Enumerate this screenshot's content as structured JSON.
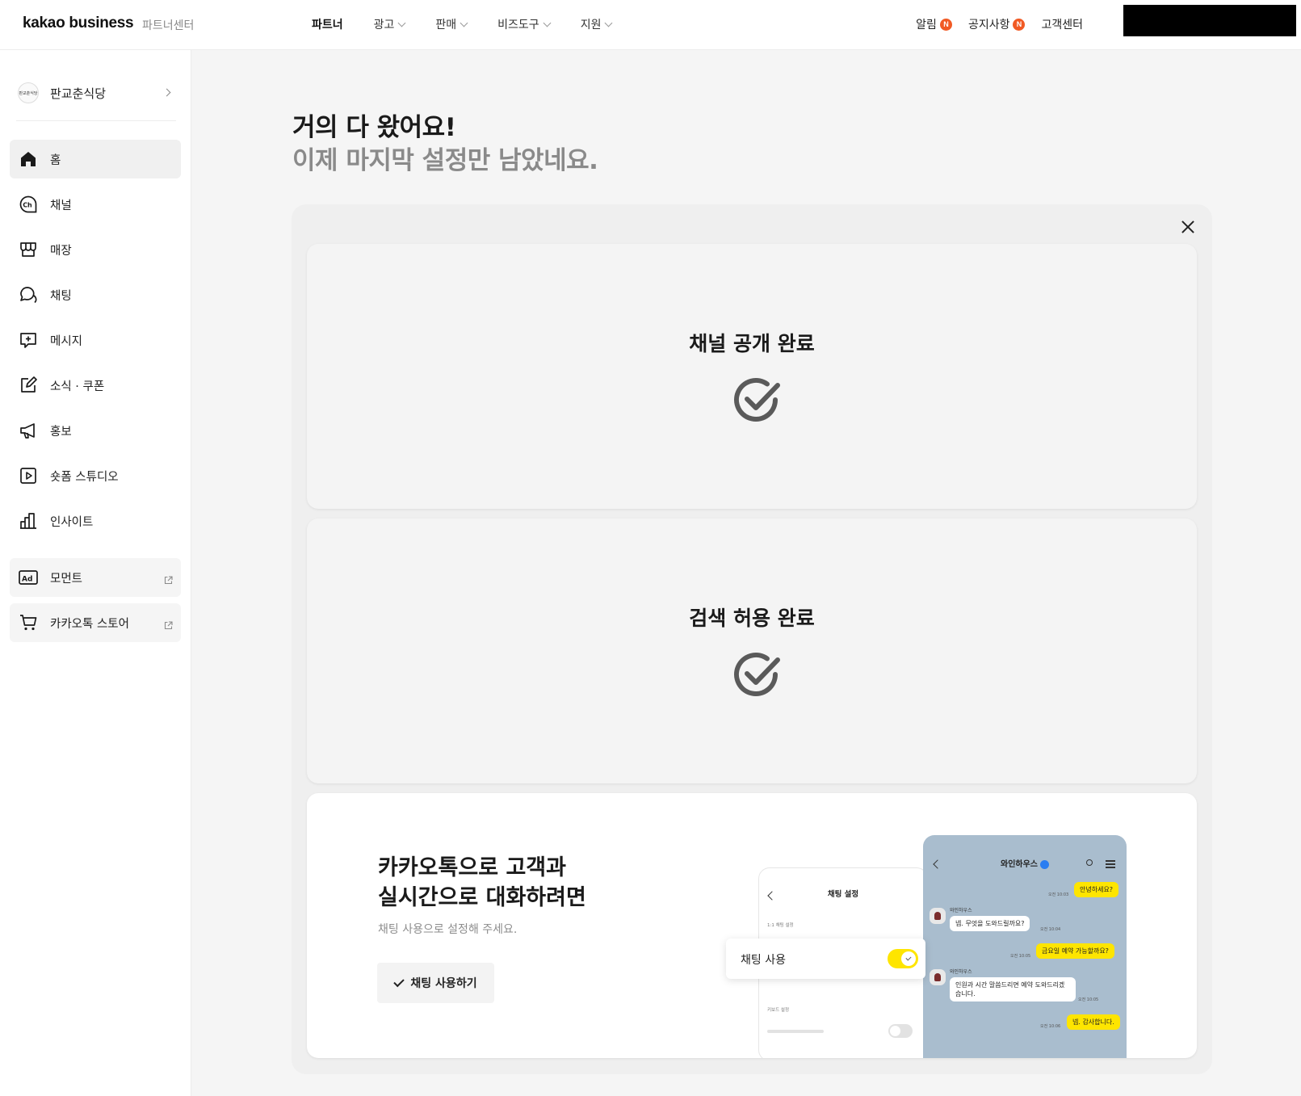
{
  "header": {
    "logo": "kakao business",
    "logo_sub": "파트너센터",
    "nav": [
      {
        "label": "파트너",
        "has_dropdown": false
      },
      {
        "label": "광고",
        "has_dropdown": true
      },
      {
        "label": "판매",
        "has_dropdown": true
      },
      {
        "label": "비즈도구",
        "has_dropdown": true
      },
      {
        "label": "지원",
        "has_dropdown": true
      }
    ],
    "util": {
      "alarm": "알림",
      "notice": "공지사항",
      "support": "고객센터",
      "badge": "N"
    }
  },
  "sidebar": {
    "profile_name": "판교춘식당",
    "profile_avatar_text": "판교춘식당",
    "items": [
      {
        "label": "홈",
        "icon": "home-icon"
      },
      {
        "label": "채널",
        "icon": "channel-icon"
      },
      {
        "label": "매장",
        "icon": "store-icon"
      },
      {
        "label": "채팅",
        "icon": "chat-icon"
      },
      {
        "label": "메시지",
        "icon": "message-icon"
      },
      {
        "label": "소식 · 쿠폰",
        "icon": "edit-icon"
      },
      {
        "label": "홍보",
        "icon": "megaphone-icon"
      },
      {
        "label": "숏폼 스튜디오",
        "icon": "play-icon"
      },
      {
        "label": "인사이트",
        "icon": "chart-icon"
      }
    ],
    "external_items": [
      {
        "label": "모먼트",
        "icon": "ad-icon"
      },
      {
        "label": "카카오톡 스토어",
        "icon": "cart-icon"
      }
    ]
  },
  "main": {
    "title": "거의 다 왔어요!",
    "subtitle": "이제 마지막 설정만 남았네요.",
    "cards": [
      {
        "title": "채널 공개 완료"
      },
      {
        "title": "검색 허용 완료"
      }
    ],
    "chat_card": {
      "title_line1": "카카오톡으로 고객과",
      "title_line2": "실시간으로 대화하려면",
      "description": "채팅 사용으로 설정해 주세요.",
      "button_label": "채팅 사용하기",
      "settings_mock": {
        "title": "채팅 설정",
        "section1": "1:1 채팅 설정",
        "section2": "키보드 설정",
        "toggle_label": "채팅 사용"
      },
      "chat_mock": {
        "title": "와인하우스",
        "sender": "와인하우스",
        "messages": [
          {
            "text": "안녕하세요?",
            "time": "오전 10:03"
          },
          {
            "text": "넵. 무엇을 도와드릴까요?",
            "time": "오전 10:04"
          },
          {
            "text": "금요일 예약 가능할까요?",
            "time": "오전 10:05"
          },
          {
            "text": "인원과 시간 말씀드리면 예약 도와드리겠습니다.",
            "time": "오전 10:05"
          },
          {
            "text": "넵. 감사합니다.",
            "time": "오전 10:06"
          }
        ]
      }
    }
  },
  "colors": {
    "accent_yellow": "#fee500",
    "badge_orange": "#f15a24",
    "chat_bg": "#a9bdce",
    "panel_bg": "#efefef"
  }
}
